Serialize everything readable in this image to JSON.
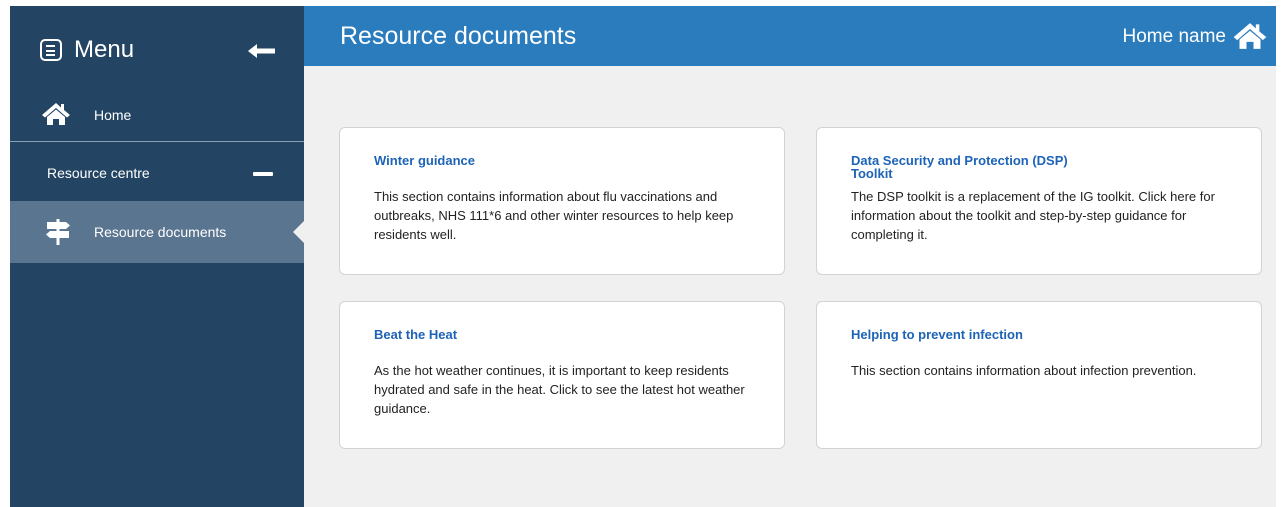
{
  "sidebar": {
    "menu_label": "Menu",
    "home_label": "Home",
    "section_label": "Resource centre",
    "active_label": "Resource documents",
    "colors": {
      "background": "#234463",
      "active": "#5a7590"
    }
  },
  "header": {
    "title": "Resource documents",
    "home_name": "Home name",
    "color": "#2a7cbd"
  },
  "cards": [
    {
      "title": "Winter guidance",
      "body": "This section contains information about flu vaccinations and outbreaks, NHS 111*6 and other winter resources to help keep residents well."
    },
    {
      "title_line1": "Data Security and Protection (DSP)",
      "title_line2": "Toolkit",
      "body": "The DSP toolkit is a replacement of the IG toolkit. Click here for information about the toolkit and step-by-step guidance for completing it."
    },
    {
      "title": "Beat the Heat",
      "body": "As the hot weather continues, it is important to keep residents hydrated and safe in the heat. Click to see the latest hot weather guidance."
    },
    {
      "title": "Helping to prevent infection",
      "body": "This section contains information about infection prevention."
    }
  ],
  "icons": [
    "menu-icon",
    "back-arrow-icon",
    "home-icon",
    "minus-icon",
    "signpost-icon"
  ]
}
